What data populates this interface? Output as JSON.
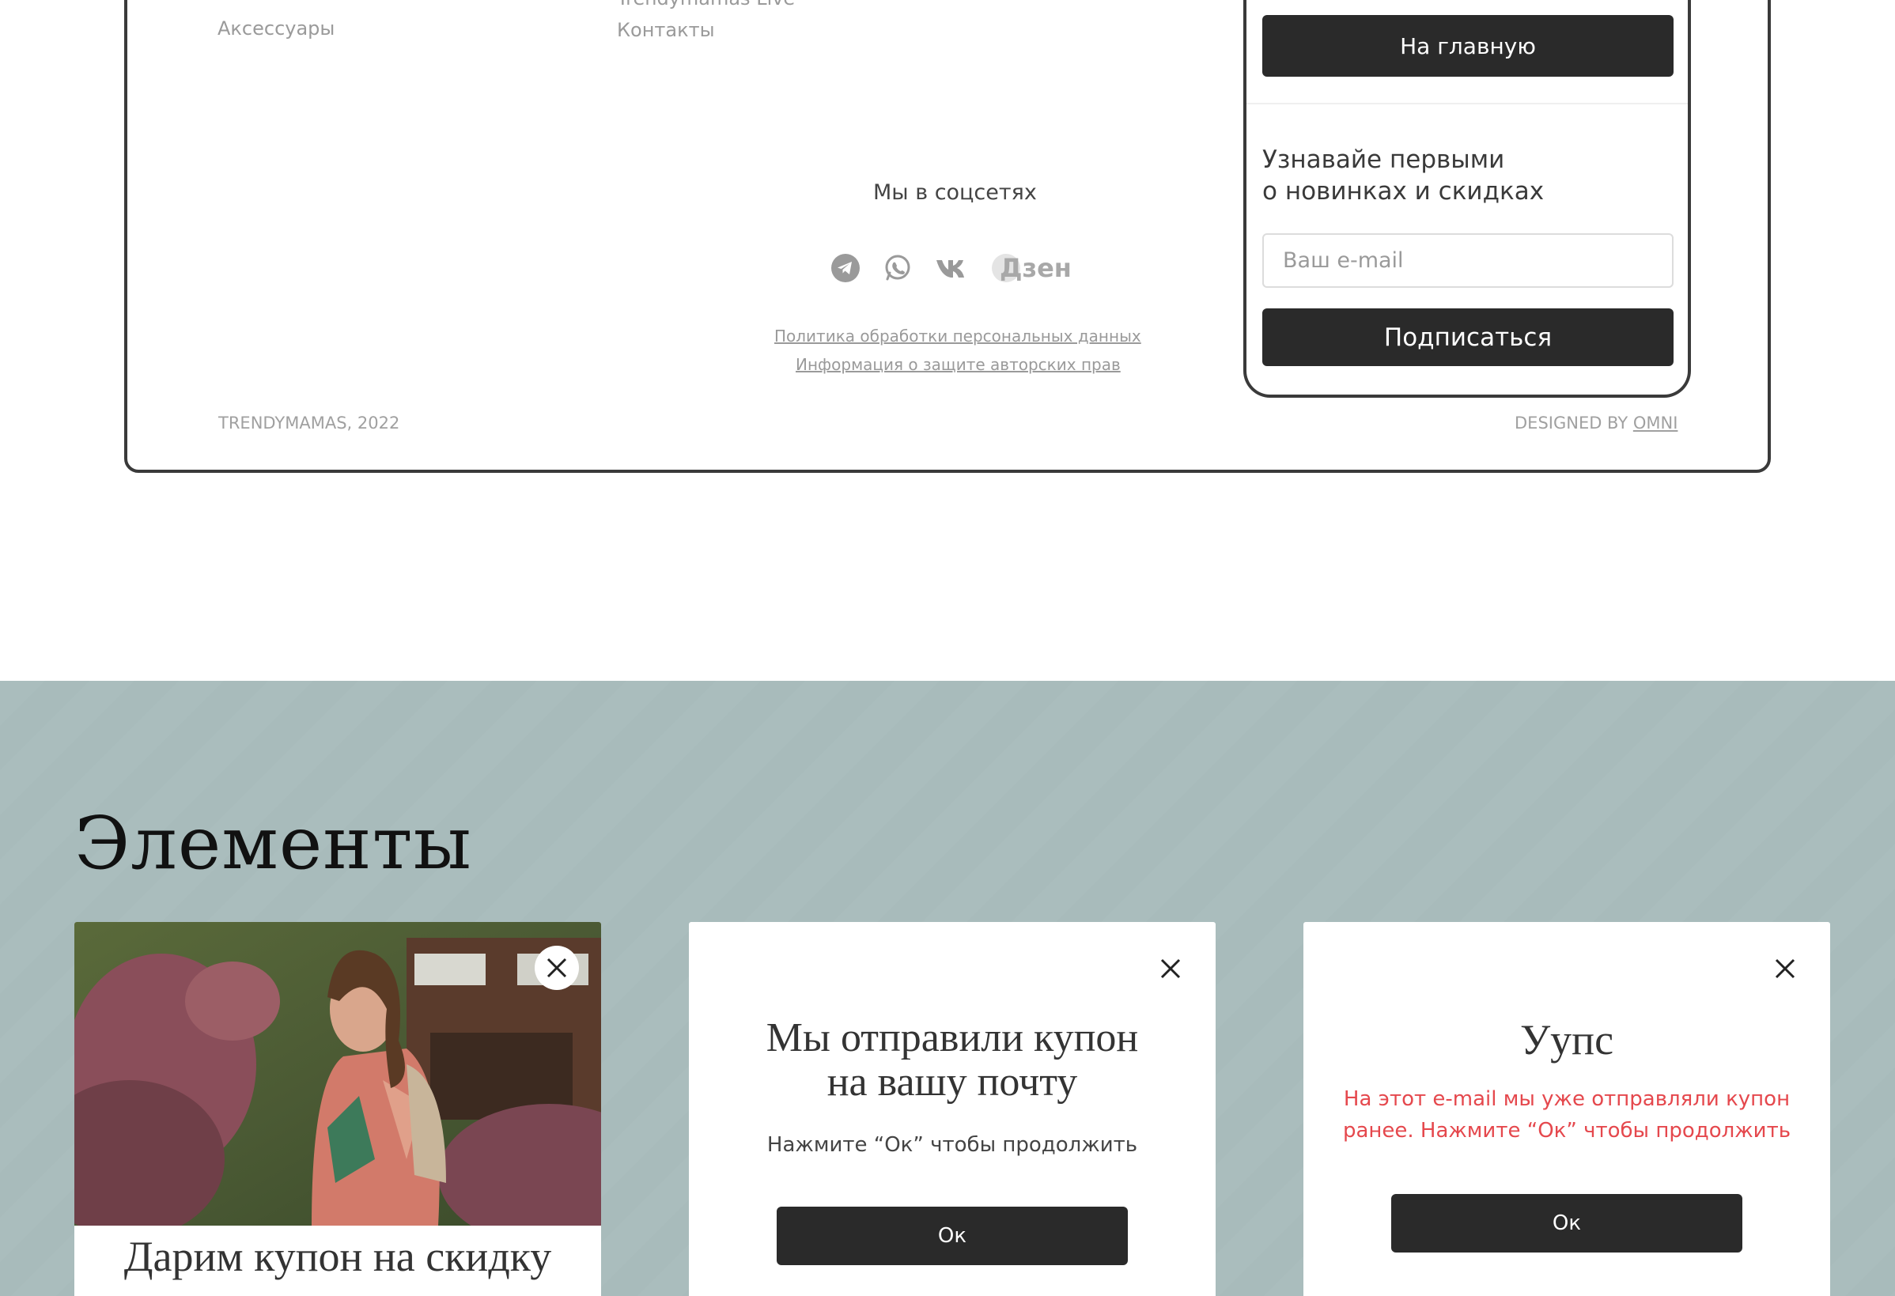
{
  "footer": {
    "nav": {
      "accessories": "Аксессуары",
      "live": "Trendymamas Live",
      "contacts": "Контакты"
    },
    "social_title": "Мы в соцсетях",
    "social_icons": [
      "telegram-icon",
      "whatsapp-icon",
      "vk-icon",
      "dzen-icon"
    ],
    "dzen_label": "Дзен",
    "legal": {
      "privacy": "Политика обработки персональных данных",
      "copyright_info": "Информация о защите авторских прав"
    },
    "copyright": "TRENDYMAMAS, 2022",
    "designed_by": "DESIGNED BY",
    "designer": "OMNI"
  },
  "side_card": {
    "home_button": "На главную",
    "subscribe_title_line1": "Узнавайе первыми",
    "subscribe_title_line2": "о новинках и скидках",
    "email_placeholder": "Ваш e-mail",
    "subscribe_button": "Подписаться"
  },
  "elements": {
    "title": "Элементы",
    "coupon_card": {
      "title": "Дарим купон на скидку"
    },
    "sent_card": {
      "title_line1": "Мы отправили купон",
      "title_line2": "на вашу почту",
      "text": "Нажмите “Ок” чтобы продолжить",
      "ok_button": "Ок"
    },
    "error_card": {
      "title": "Уупс",
      "text_line1": "На этот e-mail мы уже отправляли купон",
      "text_line2": "ранее. Нажмите “Ок” чтобы продолжить",
      "ok_button": "Ок"
    }
  },
  "colors": {
    "dark": "#2a2a2a",
    "section_bg": "#aabdbd",
    "error_text": "#e5484d",
    "muted": "#9a9a9a"
  }
}
